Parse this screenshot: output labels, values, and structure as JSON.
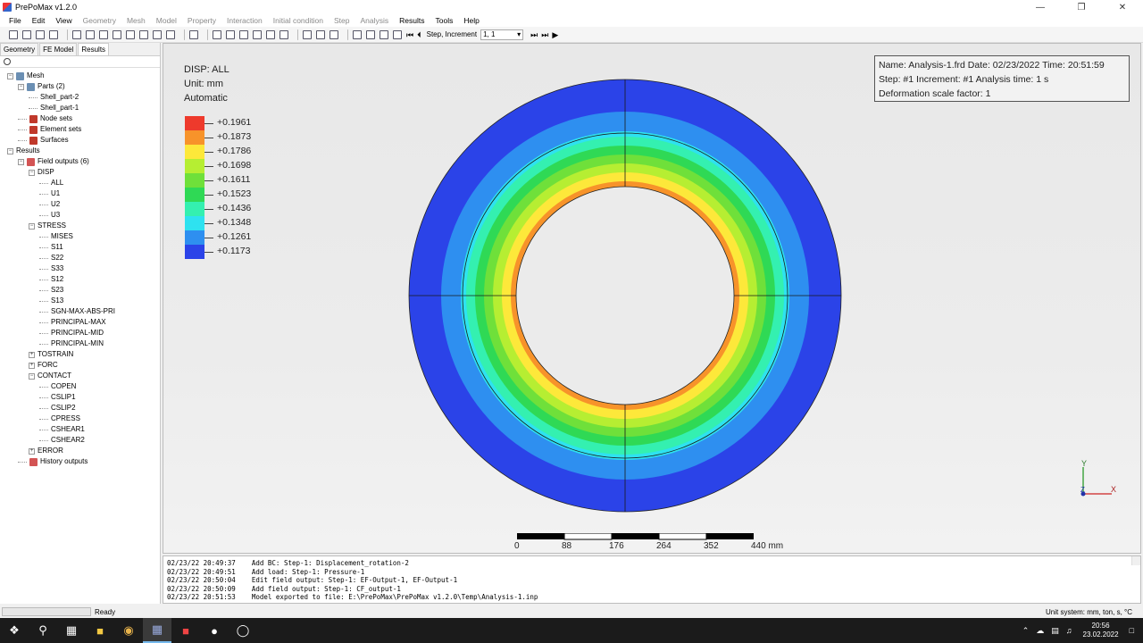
{
  "window": {
    "title": "PrePoMax v1.2.0"
  },
  "menu": [
    {
      "label": "File",
      "enabled": true
    },
    {
      "label": "Edit",
      "enabled": true
    },
    {
      "label": "View",
      "enabled": true
    },
    {
      "label": "Geometry",
      "enabled": false
    },
    {
      "label": "Mesh",
      "enabled": false
    },
    {
      "label": "Model",
      "enabled": false
    },
    {
      "label": "Property",
      "enabled": false
    },
    {
      "label": "Interaction",
      "enabled": false
    },
    {
      "label": "Initial condition",
      "enabled": false
    },
    {
      "label": "Step",
      "enabled": false
    },
    {
      "label": "Analysis",
      "enabled": false
    },
    {
      "label": "Results",
      "enabled": true
    },
    {
      "label": "Tools",
      "enabled": true
    },
    {
      "label": "Help",
      "enabled": true
    }
  ],
  "toolbar": {
    "step_label": "Step, Increment",
    "step_value": "1, 1"
  },
  "tabs": [
    "Geometry",
    "FE Model",
    "Results"
  ],
  "active_tab": "Results",
  "tree": [
    {
      "label": "Mesh",
      "level": 0,
      "expander": "-",
      "icon": "mesh-icon"
    },
    {
      "label": "Parts (2)",
      "level": 1,
      "expander": "-",
      "icon": "parts-icon"
    },
    {
      "label": "Shell_part-2",
      "level": 2,
      "expander": "",
      "icon": ""
    },
    {
      "label": "Shell_part-1",
      "level": 2,
      "expander": "",
      "icon": ""
    },
    {
      "label": "Node sets",
      "level": 1,
      "expander": "",
      "icon": "node-sets-icon"
    },
    {
      "label": "Element sets",
      "level": 1,
      "expander": "",
      "icon": "element-sets-icon"
    },
    {
      "label": "Surfaces",
      "level": 1,
      "expander": "",
      "icon": "surfaces-icon"
    },
    {
      "label": "Results",
      "level": 0,
      "expander": "-",
      "icon": ""
    },
    {
      "label": "Field outputs (6)",
      "level": 1,
      "expander": "-",
      "icon": "field-outputs-icon"
    },
    {
      "label": "DISP",
      "level": 2,
      "expander": "-",
      "icon": ""
    },
    {
      "label": "ALL",
      "level": 3,
      "expander": "",
      "icon": ""
    },
    {
      "label": "U1",
      "level": 3,
      "expander": "",
      "icon": ""
    },
    {
      "label": "U2",
      "level": 3,
      "expander": "",
      "icon": ""
    },
    {
      "label": "U3",
      "level": 3,
      "expander": "",
      "icon": ""
    },
    {
      "label": "STRESS",
      "level": 2,
      "expander": "-",
      "icon": ""
    },
    {
      "label": "MISES",
      "level": 3,
      "expander": "",
      "icon": ""
    },
    {
      "label": "S11",
      "level": 3,
      "expander": "",
      "icon": ""
    },
    {
      "label": "S22",
      "level": 3,
      "expander": "",
      "icon": ""
    },
    {
      "label": "S33",
      "level": 3,
      "expander": "",
      "icon": ""
    },
    {
      "label": "S12",
      "level": 3,
      "expander": "",
      "icon": ""
    },
    {
      "label": "S23",
      "level": 3,
      "expander": "",
      "icon": ""
    },
    {
      "label": "S13",
      "level": 3,
      "expander": "",
      "icon": ""
    },
    {
      "label": "SGN-MAX-ABS-PRI",
      "level": 3,
      "expander": "",
      "icon": ""
    },
    {
      "label": "PRINCIPAL-MAX",
      "level": 3,
      "expander": "",
      "icon": ""
    },
    {
      "label": "PRINCIPAL-MID",
      "level": 3,
      "expander": "",
      "icon": ""
    },
    {
      "label": "PRINCIPAL-MIN",
      "level": 3,
      "expander": "",
      "icon": ""
    },
    {
      "label": "TOSTRAIN",
      "level": 2,
      "expander": "+",
      "icon": ""
    },
    {
      "label": "FORC",
      "level": 2,
      "expander": "+",
      "icon": ""
    },
    {
      "label": "CONTACT",
      "level": 2,
      "expander": "-",
      "icon": ""
    },
    {
      "label": "COPEN",
      "level": 3,
      "expander": "",
      "icon": ""
    },
    {
      "label": "CSLIP1",
      "level": 3,
      "expander": "",
      "icon": ""
    },
    {
      "label": "CSLIP2",
      "level": 3,
      "expander": "",
      "icon": ""
    },
    {
      "label": "CPRESS",
      "level": 3,
      "expander": "",
      "icon": ""
    },
    {
      "label": "CSHEAR1",
      "level": 3,
      "expander": "",
      "icon": ""
    },
    {
      "label": "CSHEAR2",
      "level": 3,
      "expander": "",
      "icon": ""
    },
    {
      "label": "ERROR",
      "level": 2,
      "expander": "+",
      "icon": ""
    },
    {
      "label": "History outputs",
      "level": 1,
      "expander": "",
      "icon": "history-outputs-icon"
    }
  ],
  "legend": {
    "title": "DISP: ALL",
    "unit": "Unit: mm",
    "mode": "Automatic",
    "entries": [
      {
        "value": "+0.1961",
        "color": "#ee3a2c"
      },
      {
        "value": "+0.1873",
        "color": "#f7932a"
      },
      {
        "value": "+0.1786",
        "color": "#fde83a"
      },
      {
        "value": "+0.1698",
        "color": "#b6ee32"
      },
      {
        "value": "+0.1611",
        "color": "#6fe03a"
      },
      {
        "value": "+0.1523",
        "color": "#2fd955"
      },
      {
        "value": "+0.1436",
        "color": "#34f0b0"
      },
      {
        "value": "+0.1348",
        "color": "#2ee2f0"
      },
      {
        "value": "+0.1261",
        "color": "#2e8ff0"
      },
      {
        "value": "+0.1173",
        "color": "#2b43e8"
      }
    ],
    "last_value": "+0.1173"
  },
  "info": {
    "line1": "Name: Analysis-1.frd   Date: 02/23/2022   Time: 20:51:59",
    "line2": "Step: #1   Increment: #1   Analysis time: 1 s",
    "line3": "Deformation scale factor: 1"
  },
  "scale": {
    "labels": [
      "0",
      "88",
      "176",
      "264",
      "352",
      "440 mm"
    ]
  },
  "triad": {
    "x": "X",
    "y": "Y",
    "z": "Z"
  },
  "log": [
    "02/23/22 20:49:37    Add BC: Step-1: Displacement_rotation-2",
    "02/23/22 20:49:51    Add load: Step-1: Pressure-1",
    "02/23/22 20:50:04    Edit field output: Step-1: EF-Output-1, EF-Output-1",
    "02/23/22 20:50:09    Add field output: Step-1: CF_output-1",
    "02/23/22 20:51:53    Model exported to file: E:\\PrePoMax\\PrePoMax v1.2.0\\Temp\\Analysis-1.inp"
  ],
  "status": {
    "text": "Ready",
    "units": "Unit system: mm, ton, s, °C"
  },
  "taskbar": {
    "time": "20:56",
    "date": "23.02.2022"
  }
}
